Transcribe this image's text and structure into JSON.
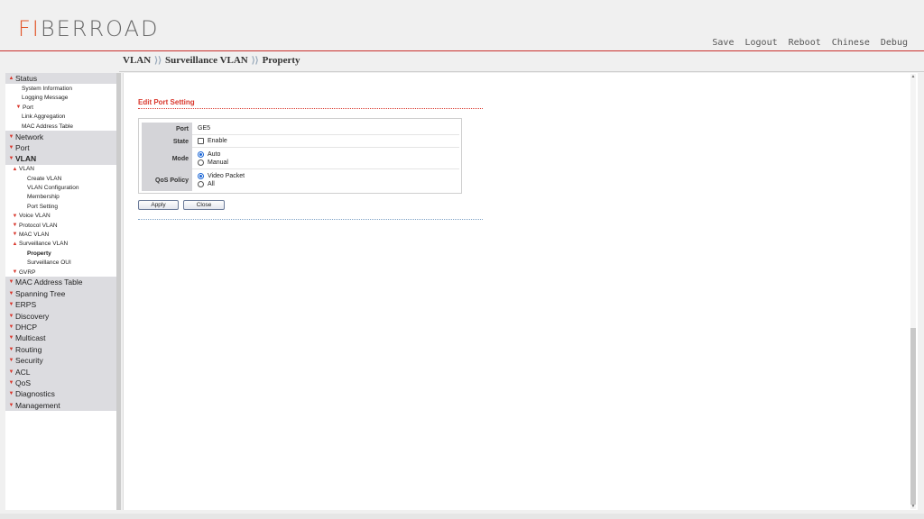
{
  "header": {
    "logo_accent": "FI",
    "logo_rest": "BERROAD",
    "nav": [
      "Save",
      "Logout",
      "Reboot",
      "Chinese",
      "Debug"
    ]
  },
  "breadcrumb": [
    "VLAN",
    "Surveillance VLAN",
    "Property"
  ],
  "sidebar": {
    "status": "Status",
    "system_information": "System Information",
    "logging_message": "Logging Message",
    "status_port": "Port",
    "link_aggregation": "Link Aggregation",
    "mac_address_table_sub": "MAC Address Table",
    "network": "Network",
    "port": "Port",
    "vlan": "VLAN",
    "vlan_sub": "VLAN",
    "create_vlan": "Create VLAN",
    "vlan_configuration": "VLAN Configuration",
    "membership": "Membership",
    "port_setting": "Port Setting",
    "voice_vlan": "Voice VLAN",
    "protocol_vlan": "Protocol VLAN",
    "mac_vlan": "MAC VLAN",
    "surveillance_vlan": "Surveillance VLAN",
    "property": "Property",
    "surveillance_oui": "Surveillance OUI",
    "gvrp": "GVRP",
    "mac_address_table": "MAC Address Table",
    "spanning_tree": "Spanning Tree",
    "erps": "ERPS",
    "discovery": "Discovery",
    "dhcp": "DHCP",
    "multicast": "Multicast",
    "routing": "Routing",
    "security": "Security",
    "acl": "ACL",
    "qos": "QoS",
    "diagnostics": "Diagnostics",
    "management": "Management"
  },
  "form": {
    "title": "Edit Port Setting",
    "port_label": "Port",
    "port_value": "GE5",
    "state_label": "State",
    "state_option": "Enable",
    "mode_label": "Mode",
    "mode_auto": "Auto",
    "mode_manual": "Manual",
    "qos_label": "QoS Policy",
    "qos_video": "Video Packet",
    "qos_all": "All",
    "apply": "Apply",
    "close": "Close"
  },
  "colors": {
    "accent": "#d9362b",
    "logo": "#e2572a"
  }
}
